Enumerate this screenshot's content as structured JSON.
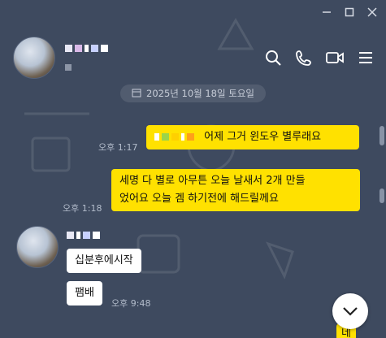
{
  "window": {
    "minimize_icon": "minimize-icon",
    "maximize_icon": "maximize-icon",
    "close_icon": "close-icon"
  },
  "header": {
    "chat_name": "ᆢᆞᅵ ᄀᆢ",
    "member_count": "ᆢ",
    "icons": [
      "search-icon",
      "phone-icon",
      "video-call-icon",
      "menu-icon"
    ]
  },
  "date_divider": "2025년 10월 18일 토요일",
  "messages": {
    "out1": {
      "text": "어제 그거 윈도우 별루래요",
      "time": "오후 1:17"
    },
    "out2": {
      "line1": "세명 다 별로 아무튼 오늘 날새서 2개 만들",
      "line2": "었어요 오늘 겜 하기전에 해드릴께요",
      "time": "오후 1:18"
    },
    "sender_name": "ᆢᆢ ᆢᆢ",
    "in1": {
      "text": "십분후에시작"
    },
    "in2": {
      "text": "팸배",
      "time": "오후 9:48"
    },
    "out3": {
      "text": "네"
    }
  },
  "colors": {
    "background": "#3e4a5f",
    "my_bubble": "#ffe100",
    "their_bubble": "#ffffff"
  }
}
